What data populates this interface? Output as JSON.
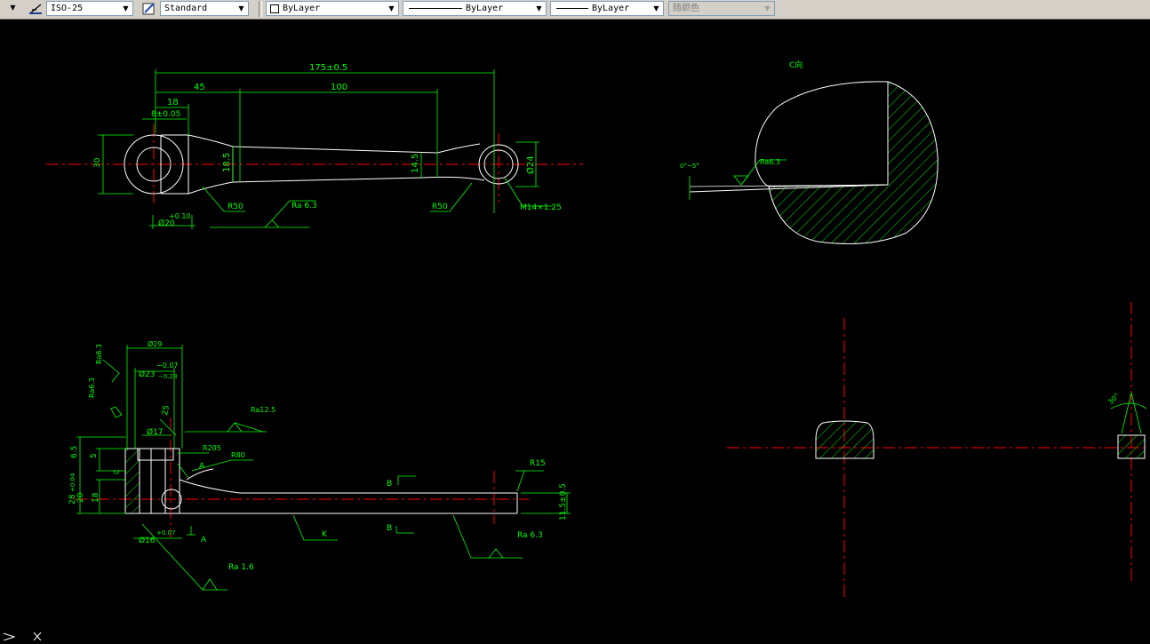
{
  "toolbar": {
    "dimstyle": "ISO-25",
    "textstyle": "Standard",
    "layer": "ByLayer",
    "linetype": "ByLayer",
    "lineweight": "ByLayer",
    "plotstyle": "随颜色"
  },
  "colors": {
    "background": "#000000",
    "geometry": "#ffffff",
    "dimension": "#00ff00",
    "centerline": "#ff0000"
  },
  "drawing": {
    "top_view": {
      "d_overall": "175±0.5",
      "d_45": "45",
      "d_100": "100",
      "d_18": "18",
      "d_8": "8±0.05",
      "d_30": "30",
      "d_185": "18.5",
      "d_145": "14.5",
      "d_24": "Ø24",
      "r50_left": "R50",
      "r50_right": "R50",
      "ra": "Ra 6.3",
      "thread": "M14×1.25",
      "tol": "+0.10",
      "d_bore": "Ø20"
    },
    "section_c": {
      "title": "C向",
      "angle": "0°~5°",
      "ra": "Ra6.3"
    },
    "front_view": {
      "d29": "Ø29",
      "tol_upper": "−0.07",
      "d23": "Ø23",
      "tol_lower": "−0.28",
      "ra_left1": "Ra6.3",
      "ra_left2": "Ra6.3",
      "d25": "25",
      "ra125": "Ra12.5",
      "d17": "Ø17",
      "r205": "R205",
      "a_label": "A",
      "r80": "R80",
      "r15": "R15",
      "b_upper": "B",
      "b_lower": "B",
      "d65": "6.5",
      "d5": "5",
      "c_label": "C",
      "tol_28": "+0.04",
      "d28": "28",
      "d20": "20",
      "d18": "18",
      "d115": "11.5±0.5",
      "k_label": "K",
      "a_lower": "A",
      "ra_right": "Ra 6.3",
      "tol_16": "+0.07",
      "d16": "Ø16",
      "ra16": "Ra 1.6"
    },
    "section_b": {
      "angle": "30°"
    }
  }
}
